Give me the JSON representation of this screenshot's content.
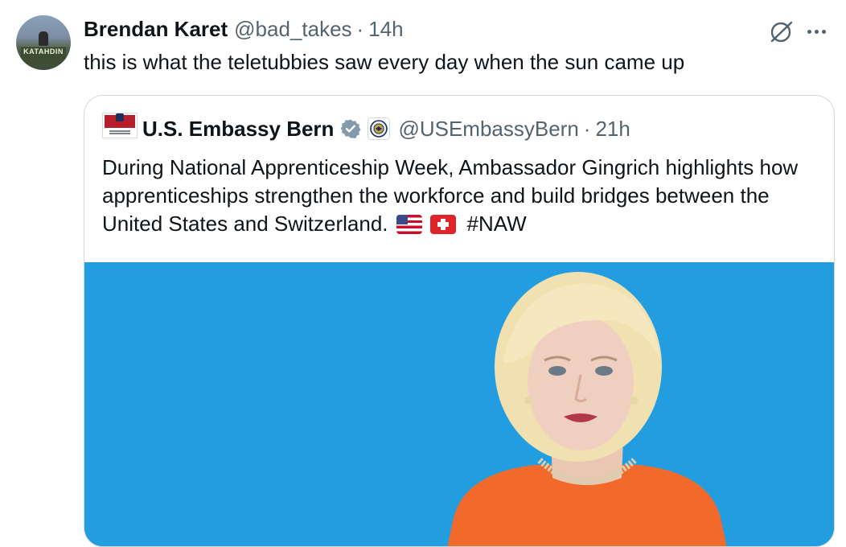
{
  "tweet": {
    "author_name": "Brendan Karet",
    "handle": "@bad_takes",
    "separator": "·",
    "time": "14h",
    "text": "this is what the teletubbies saw every day when the sun came up",
    "avatar_sign_text": "KATAHDIN"
  },
  "quoted_tweet": {
    "author_name": "U.S. Embassy Bern",
    "handle": "@USEmbassyBern",
    "separator": "·",
    "time": "21h",
    "text": "During National Apprenticeship Week, Ambassador Gingrich highlights how apprenticeships strengthen the workforce and build bridges between the United States and Switzerland.",
    "hashtag": "#NAW",
    "media_background": "#229ee0"
  },
  "icons": {
    "grok": "grok-icon",
    "more": "more-icon",
    "verified": "verified-badge-icon",
    "gov": "government-seal-icon"
  },
  "colors": {
    "text_primary": "#0f1419",
    "text_secondary": "#536471",
    "border": "#cfd9de",
    "verified_badge": "#829aab"
  }
}
